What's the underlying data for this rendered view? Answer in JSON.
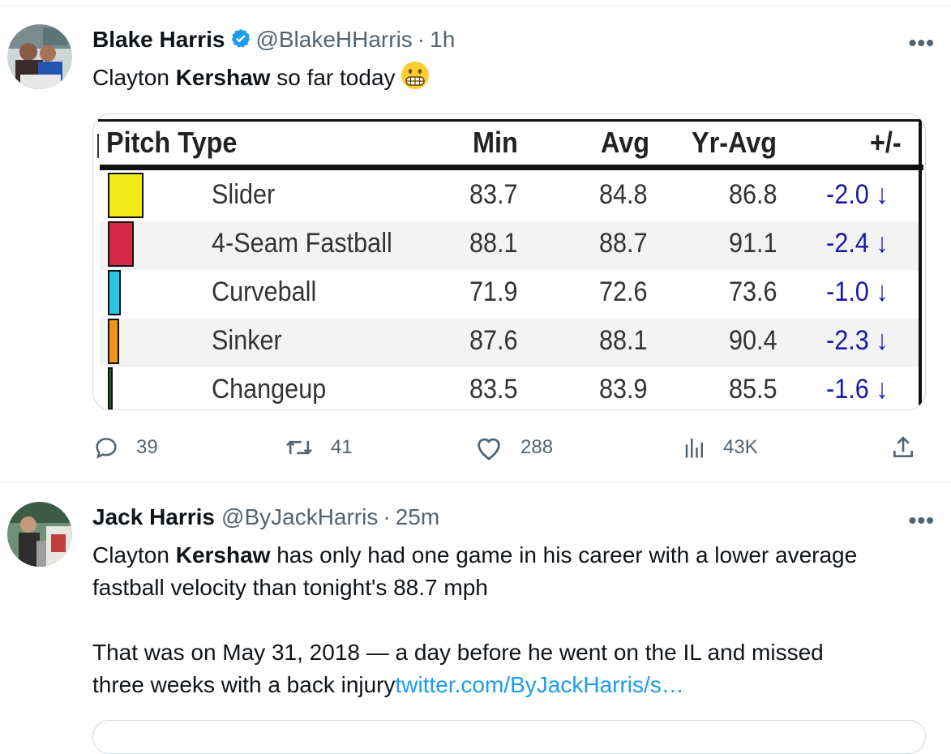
{
  "tweets": [
    {
      "author": {
        "name": "Blake Harris",
        "handle": "@BlakeHHarris",
        "verified": true
      },
      "separator": "·",
      "time": "1h",
      "more": "•••",
      "text": {
        "part1": "Clayton ",
        "bold": "Kershaw",
        "part2": " so far today"
      },
      "emoji": "grimacing-face",
      "media": {
        "columns": [
          "Pitch Type",
          "Min",
          "Avg",
          "Yr-Avg",
          "+/-"
        ],
        "rows": [
          {
            "color": "#f2ec1a",
            "type": "Slider",
            "min": "83.7",
            "avg": "84.8",
            "yr_avg": "86.8",
            "diff": "-2.0 ↓"
          },
          {
            "color": "#d62848",
            "type": "4-Seam Fastball",
            "min": "88.1",
            "avg": "88.7",
            "yr_avg": "91.1",
            "diff": "-2.4 ↓"
          },
          {
            "color": "#2bc4e6",
            "type": "Curveball",
            "min": "71.9",
            "avg": "72.6",
            "yr_avg": "73.6",
            "diff": "-1.0 ↓"
          },
          {
            "color": "#f0961c",
            "type": "Sinker",
            "min": "87.6",
            "avg": "88.1",
            "yr_avg": "90.4",
            "diff": "-2.3 ↓"
          },
          {
            "color": "#1f6b3a",
            "type": "Changeup",
            "min": "83.5",
            "avg": "83.9",
            "yr_avg": "85.5",
            "diff": "-1.6 ↓"
          }
        ]
      },
      "actions": {
        "replies": "39",
        "reposts": "41",
        "likes": "288",
        "views": "43K"
      }
    },
    {
      "author": {
        "name": "Jack Harris",
        "handle": "@ByJackHarris",
        "verified": false
      },
      "separator": "·",
      "time": "25m",
      "more": "•••",
      "text": {
        "l1a": "Clayton ",
        "l1b": "Kershaw",
        "l1c": " has only had one game in his career with a lower average",
        "l2": "fastball velocity than tonight's 88.7 mph",
        "l3": "That was on May 31, 2018 — a day before he went on the IL and missed",
        "l4": "three weeks with a back injury",
        "link": "twitter.com/ByJackHarris/s…"
      }
    }
  ],
  "colors": {
    "link": "#1d9bf0",
    "verified": "#1d9bf0",
    "muted": "#536471",
    "diff": "#1a1aa8"
  }
}
